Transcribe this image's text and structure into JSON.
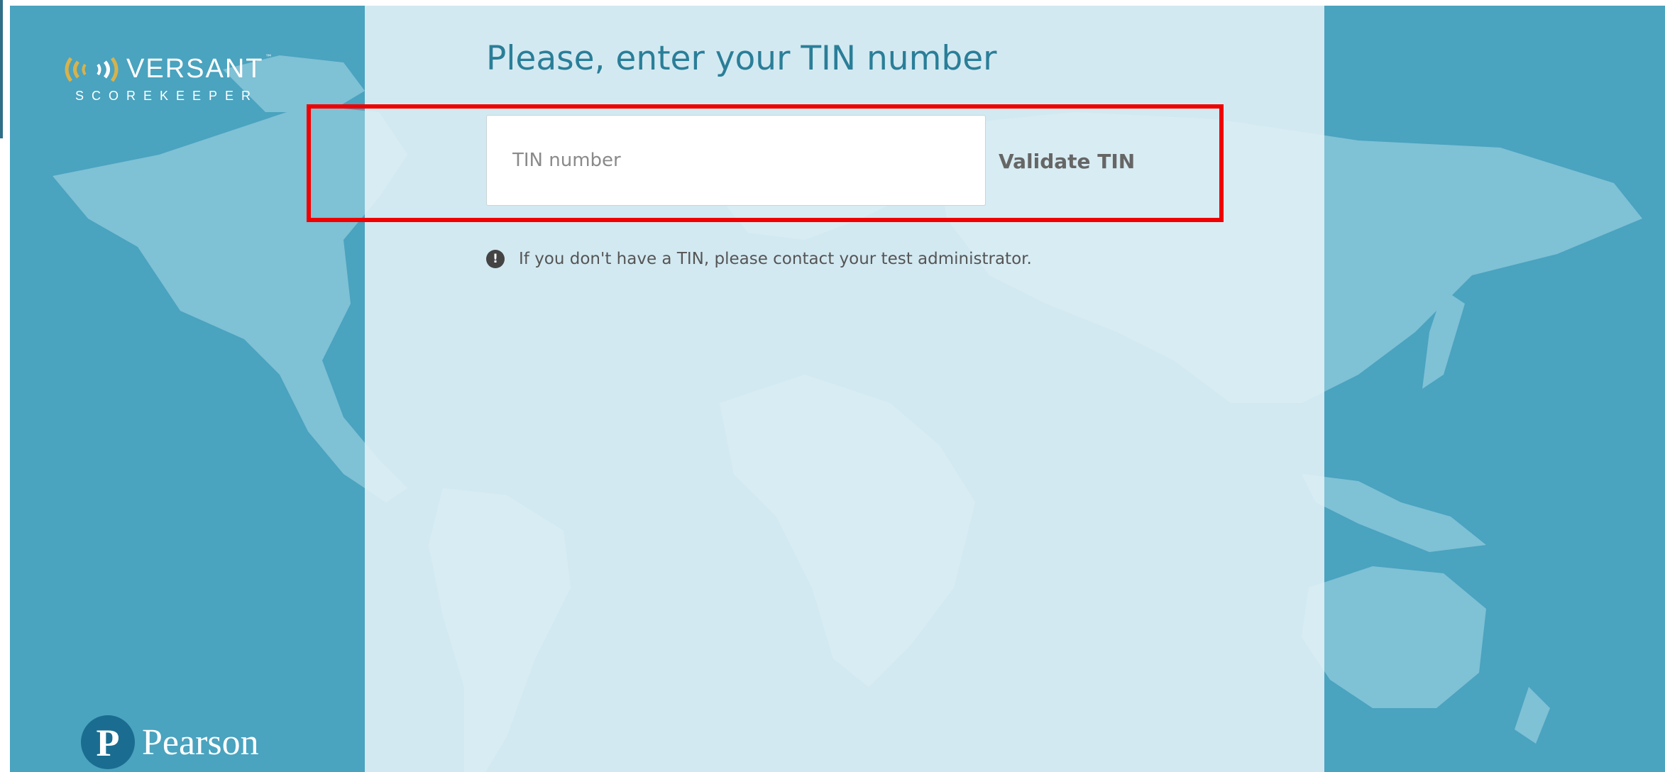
{
  "brand": {
    "name": "VERSANT",
    "trademark": "™",
    "subtitle": "SCOREKEEPER",
    "logo_icon": "sound-waves-icon",
    "logo_color": "#d8b24a"
  },
  "form": {
    "title": "Please, enter your TIN number",
    "input_placeholder": "TIN number",
    "input_value": "",
    "validate_label": "Validate TIN"
  },
  "notice": {
    "icon": "exclamation-circle-icon",
    "icon_glyph": "!",
    "text": "If you don't have a TIN, please contact your test administrator."
  },
  "footer": {
    "pearson_glyph": "P",
    "pearson_name": "Pearson"
  },
  "colors": {
    "background": "#4aa3bf",
    "panel": "#e2f1f6",
    "land": "#7fc1d5",
    "title": "#2a7e98",
    "highlight": "#f00000",
    "pearson_blue": "#1a6d90"
  }
}
